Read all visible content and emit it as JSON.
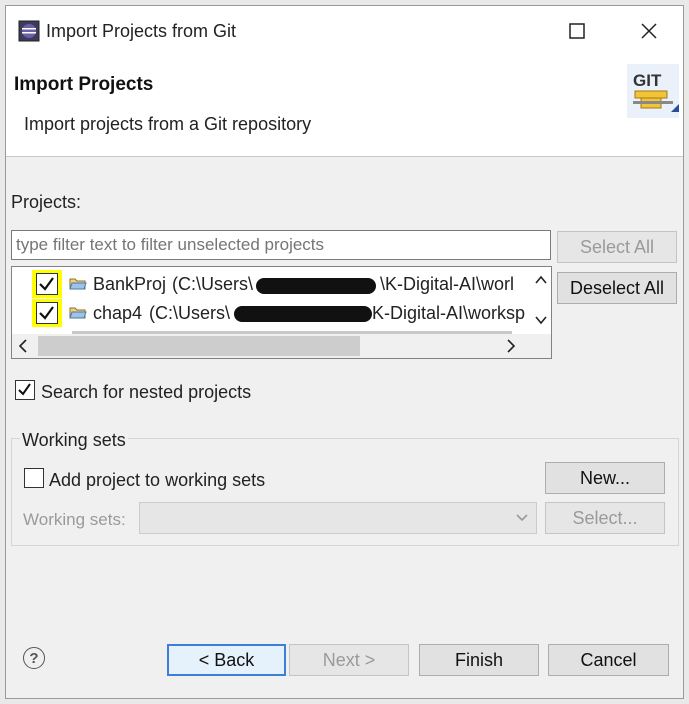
{
  "window": {
    "title": "Import Projects from Git"
  },
  "banner": {
    "title": "Import Projects",
    "description": "Import projects from a Git repository",
    "icon_text": "GIT"
  },
  "projects": {
    "label": "Projects:",
    "filter_placeholder": "type filter text to filter unselected projects",
    "select_all": "Select All",
    "deselect_all": "Deselect All",
    "items": [
      {
        "name": "BankProj",
        "path_start": "(C:\\Users\\",
        "path_end": "\\K-Digital-AI\\worl",
        "checked": true
      },
      {
        "name": "chap4",
        "path_start": "(C:\\Users\\",
        "path_end": "K-Digital-AI\\worksp",
        "checked": true
      }
    ]
  },
  "nested": {
    "label": "Search for nested projects",
    "checked": true
  },
  "working_sets": {
    "group_title": "Working sets",
    "add_label": "Add project to working sets",
    "add_checked": false,
    "new_button": "New...",
    "sets_label": "Working sets:",
    "sets_value": "",
    "select_button": "Select..."
  },
  "footer": {
    "back": "< Back",
    "next": "Next >",
    "finish": "Finish",
    "cancel": "Cancel"
  },
  "colors": {
    "highlight": "#ffff00",
    "accent": "#3c7fd6",
    "window_bg": "#f0f0f0"
  },
  "icons": {
    "app": "eclipse-icon",
    "git": "git-repository-icon",
    "folder": "project-folder-icon",
    "help": "help-icon"
  }
}
